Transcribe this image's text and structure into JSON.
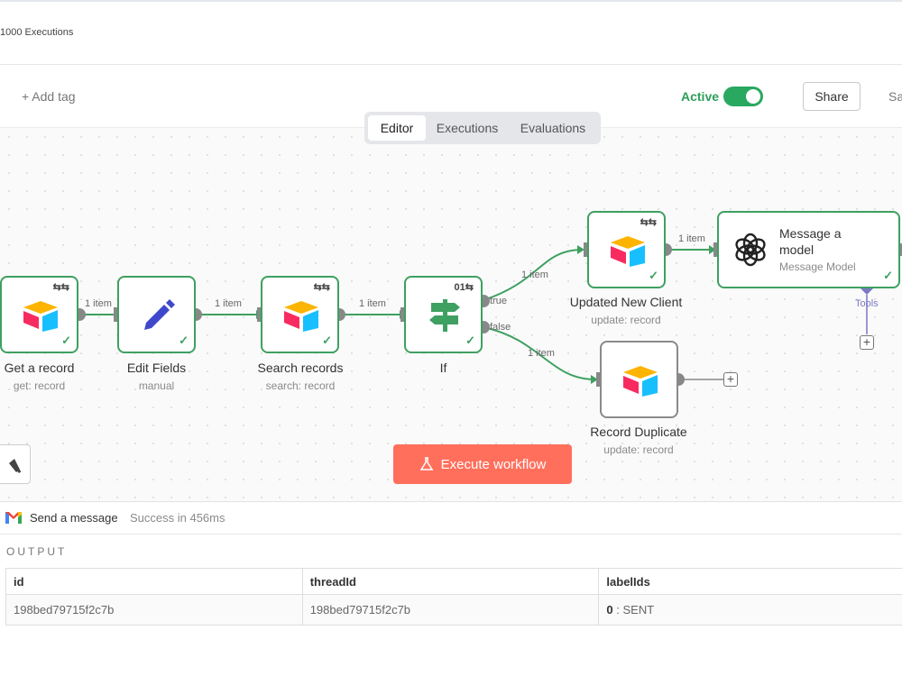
{
  "topbar": {
    "executions_count": "1000 Executions"
  },
  "header": {
    "add_tag": "+ Add tag",
    "active_label": "Active",
    "active_toggle": true,
    "share_label": "Share",
    "save_label": "Save"
  },
  "tabs": [
    {
      "label": "Editor",
      "active": true
    },
    {
      "label": "Executions",
      "active": false
    },
    {
      "label": "Evaluations",
      "active": false
    }
  ],
  "nodes": {
    "get_record": {
      "title": "Get a record",
      "subtitle": "get: record",
      "icon": "airtable-icon"
    },
    "edit_fields": {
      "title": "Edit Fields",
      "subtitle": "manual",
      "icon": "pencil-icon"
    },
    "search_records": {
      "title": "Search records",
      "subtitle": "search: record",
      "icon": "airtable-icon"
    },
    "if": {
      "title": "If",
      "subtitle": "",
      "icon": "signpost-icon",
      "mini": "01⇆"
    },
    "updated_client": {
      "title": "Updated New Client",
      "subtitle": "update: record",
      "icon": "airtable-icon"
    },
    "message_model": {
      "title": "Message a model",
      "subtitle": "Message Model",
      "icon": "openai-icon"
    },
    "record_duplicate": {
      "title": "Record Duplicate",
      "subtitle": "update: record",
      "icon": "airtable-icon"
    }
  },
  "edges": {
    "e1": "1 item",
    "e2": "1 item",
    "e3": "1 item",
    "e_true_items": "1 item",
    "e_false_items": "1 item",
    "e_model": "1 item",
    "true_label": "true",
    "false_label": "false",
    "tools_label": "Tools"
  },
  "execute_button": {
    "label": "Execute workflow"
  },
  "panel": {
    "node_name": "Send a message",
    "status": "Success in 456ms",
    "output_label": "OUTPUT",
    "columns": [
      "id",
      "threadId",
      "labelIds"
    ],
    "rows": [
      {
        "id": "198bed79715f2c7b",
        "threadId": "198bed79715f2c7b",
        "labelIds_key": "0",
        "labelIds_value": "SENT"
      }
    ]
  },
  "colors": {
    "accent_green": "#3ea061",
    "execute_orange": "#ff6f5c",
    "tools_purple": "#7b78c4"
  }
}
